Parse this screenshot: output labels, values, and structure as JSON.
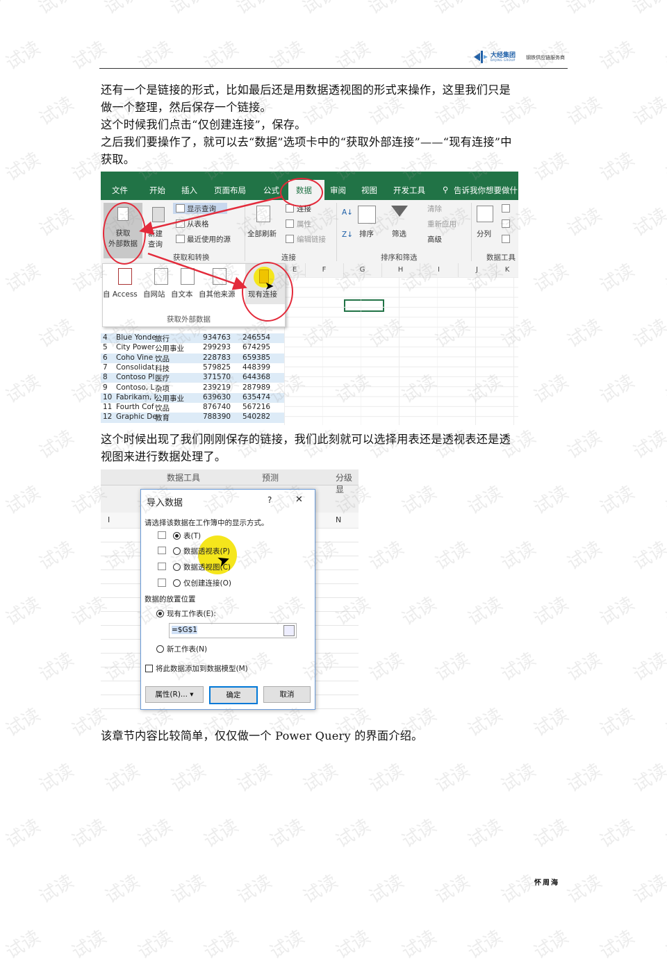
{
  "header": {
    "logo_cn": "大经集团",
    "logo_en": "DAJING GROUP",
    "slogan": "钢铁供应链服务商"
  },
  "paragraphs": [
    "还有一个是链接的形式，比如最后还是用数据透视图的形式来操作，这里我们只是\n做一个整理，然后保存一个链接。",
    "这个时候我们点击“仅创建连接”，保存。",
    "之后我们要操作了，就可以去“数据”选项卡中的“获取外部连接”——“现有连接”中\n获取。",
    "这个时候出现了我们刚刚保存的链接，我们此刻就可以选择用表还是透视表还是透\n视图来进行数据处理了。",
    "该章节内容比较简单，仅仅做一个 Power Query 的界面介绍。"
  ],
  "excel_ribbon": {
    "tabs": [
      "文件",
      "开始",
      "插入",
      "页面布局",
      "公式",
      "数据",
      "审阅",
      "视图",
      "开发工具",
      "告诉我你想要做什"
    ],
    "active_tab": "数据",
    "buttons": {
      "get_external_data": "获取\n外部数据",
      "new_query": "新建\n查询",
      "show_queries": "显示查询",
      "from_table": "从表格",
      "recent_sources": "最近使用的源",
      "refresh_all": "全部刷新",
      "connections": "连接",
      "properties": "属性",
      "edit_links": "编辑链接",
      "sort": "排序",
      "filter": "筛选",
      "clear": "清除",
      "reapply": "重新应用",
      "advanced": "高级",
      "split": "分列"
    },
    "groups": [
      "获取和转换",
      "连接",
      "排序和筛选",
      "数据工具"
    ],
    "dropdown_items": [
      "自 Access",
      "自网站",
      "自文本",
      "自其他来源",
      "现有连接"
    ],
    "dropdown_group": "获取外部数据",
    "columns": [
      "E",
      "F",
      "G",
      "H",
      "I",
      "J",
      "K"
    ],
    "rows": [
      {
        "n": "4",
        "a": "Blue Yonde",
        "b": "旅行",
        "c": "934763",
        "d": "246554"
      },
      {
        "n": "5",
        "a": "City Power",
        "b": "公用事业",
        "c": "299293",
        "d": "674295"
      },
      {
        "n": "6",
        "a": "Coho Vine",
        "b": "饮品",
        "c": "228783",
        "d": "659385"
      },
      {
        "n": "7",
        "a": "Consolidat",
        "b": "科技",
        "c": "579825",
        "d": "448399"
      },
      {
        "n": "8",
        "a": "Contoso Pl",
        "b": "医疗",
        "c": "371570",
        "d": "644368"
      },
      {
        "n": "9",
        "a": "Contoso, L",
        "b": "杂项",
        "c": "239219",
        "d": "287989"
      },
      {
        "n": "10",
        "a": "Fabrikam, I",
        "b": "公用事业",
        "c": "639630",
        "d": "635474"
      },
      {
        "n": "11",
        "a": "Fourth Cof",
        "b": "饮品",
        "c": "876740",
        "d": "567216"
      },
      {
        "n": "12",
        "a": "Graphic De",
        "b": "教育",
        "c": "788390",
        "d": "540282"
      }
    ]
  },
  "import_dialog": {
    "bg_labels": [
      "数据工具",
      "预测",
      "分级显"
    ],
    "bg_cols": [
      "I",
      "N"
    ],
    "title": "导入数据",
    "help": "?",
    "close": "✕",
    "prompt": "请选择该数据在工作簿中的显示方式。",
    "options": [
      "表(T)",
      "数据透视表(P)",
      "数据透视图(C)",
      "仅创建连接(O)"
    ],
    "selected_option": "表(T)",
    "location_label": "数据的放置位置",
    "existing_sheet": "现有工作表(E):",
    "cell_ref": "=$G$1",
    "new_sheet": "新工作表(N)",
    "add_model": "将此数据添加到数据模型(M)",
    "btn_properties": "属性(R)...",
    "btn_ok": "确定",
    "btn_cancel": "取消"
  },
  "footer": {
    "author": "怀周海"
  },
  "colors": {
    "excel_green": "#217346",
    "highlight_red": "#e32a3a",
    "highlight_yellow": "#f5e61c",
    "brand_blue": "#1d5fa8"
  }
}
